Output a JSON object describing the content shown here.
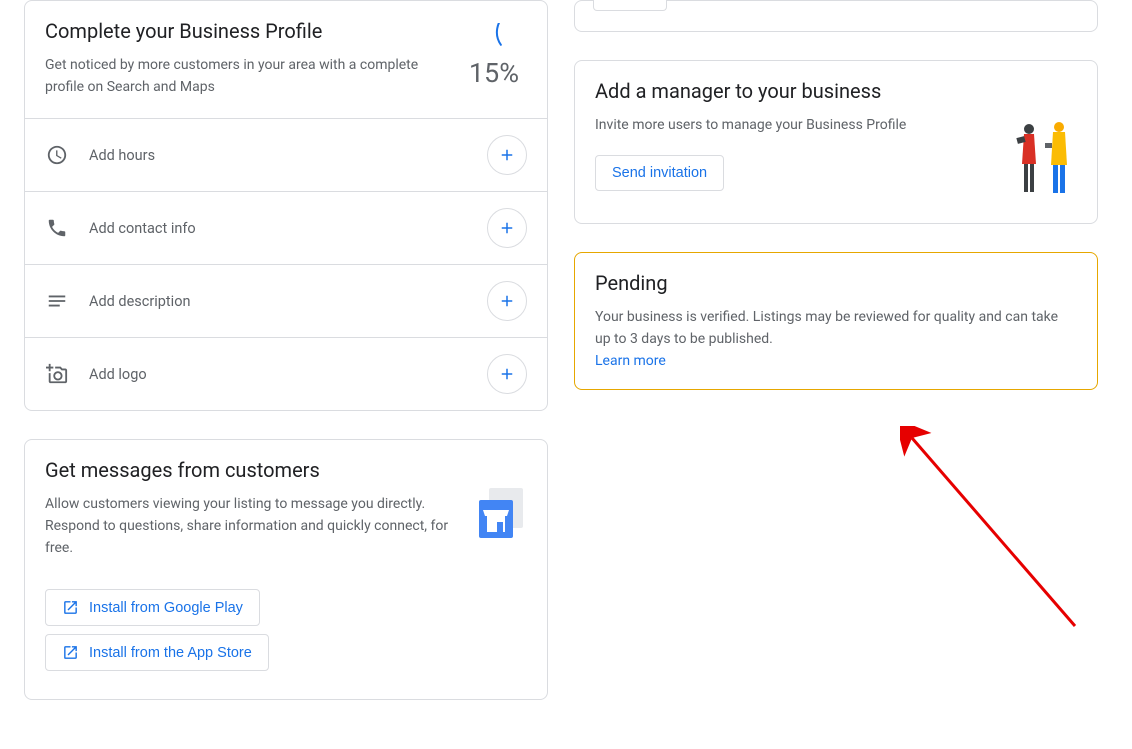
{
  "profile": {
    "title": "Complete your Business Profile",
    "desc": "Get noticed by more customers in your area with a complete profile on Search and Maps",
    "pct": "15%",
    "actions": [
      {
        "label": "Add hours"
      },
      {
        "label": "Add contact info"
      },
      {
        "label": "Add description"
      },
      {
        "label": "Add logo"
      }
    ]
  },
  "messages": {
    "title": "Get messages from customers",
    "desc": "Allow customers viewing your listing to message you directly. Respond to questions, share information and quickly connect, for free.",
    "install_play": "Install from Google Play",
    "install_app": "Install from the App Store"
  },
  "manager": {
    "title": "Add a manager to your business",
    "desc": "Invite more users to manage your Business Profile",
    "button": "Send invitation"
  },
  "pending": {
    "title": "Pending",
    "desc": "Your business is verified. Listings may be reviewed for quality and can take up to 3 days to be published.",
    "learn": "Learn more"
  },
  "colors": {
    "link": "#1a73e8",
    "text_secondary": "#5f6368",
    "border": "#dadce0",
    "warning_border": "#e6a700",
    "arrow": "#e60000"
  }
}
